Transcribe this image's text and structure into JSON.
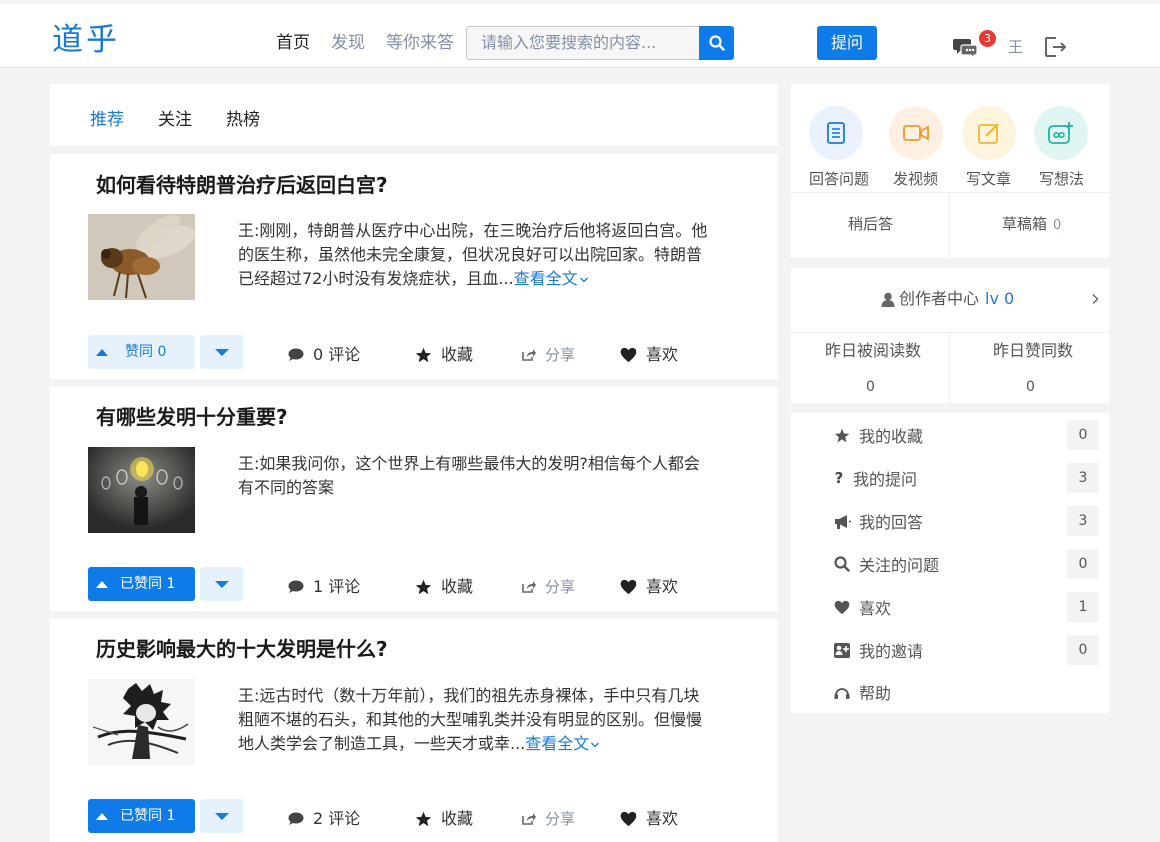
{
  "header": {
    "logo": "道乎",
    "nav": [
      {
        "label": "首页",
        "active": true
      },
      {
        "label": "发现",
        "active": false
      },
      {
        "label": "等你来答",
        "active": false
      }
    ],
    "search_placeholder": "请输入您要搜索的内容...",
    "ask_label": "提问",
    "message_badge": "3",
    "user_name": "王"
  },
  "tabs": [
    {
      "label": "推荐",
      "active": true
    },
    {
      "label": "关注",
      "active": false
    },
    {
      "label": "热榜",
      "active": false
    }
  ],
  "feed": [
    {
      "title": "如何看待特朗普治疗后返回白宫?",
      "excerpt": "王:刚刚，特朗普从医疗中心出院，在三晚治疗后他将返回白宫。他的医生称，虽然他未完全康复，但状况良好可以出院回家。特朗普已经超过72小时没有发烧症状，且血...",
      "read_more": "查看全文",
      "vote_label": "赞同 0",
      "voted": false,
      "comments": "0 评论",
      "collect": "收藏",
      "share": "分享",
      "like": "喜欢"
    },
    {
      "title": "有哪些发明十分重要?",
      "excerpt": "王:如果我问你，这个世界上有哪些最伟大的发明?相信每个人都会有不同的答案",
      "read_more": "",
      "vote_label": "已赞同 1",
      "voted": true,
      "comments": "1 评论",
      "collect": "收藏",
      "share": "分享",
      "like": "喜欢"
    },
    {
      "title": "历史影响最大的十大发明是什么?",
      "excerpt": "王:远古时代（数十万年前），我们的祖先赤身裸体，手中只有几块粗陋不堪的石头，和其他的大型哺乳类并没有明显的区别。但慢慢地人类学会了制造工具，一些天才或幸...",
      "read_more": "查看全文",
      "vote_label": "已赞同 1",
      "voted": true,
      "comments": "2 评论",
      "collect": "收藏",
      "share": "分享",
      "like": "喜欢"
    }
  ],
  "sidebar": {
    "quick_actions": [
      {
        "label": "回答问题",
        "icon": "document-icon",
        "color": "#1a7ad6",
        "bg": "#e8f1fc"
      },
      {
        "label": "发视频",
        "icon": "video-icon",
        "color": "#f0982a",
        "bg": "#fdf0e2"
      },
      {
        "label": "写文章",
        "icon": "edit-icon",
        "color": "#f2b72e",
        "bg": "#fdf4de"
      },
      {
        "label": "写想法",
        "icon": "idea-icon",
        "color": "#1fb3a6",
        "bg": "#e1f5f3"
      }
    ],
    "later_answer": "稍后答",
    "drafts_label": "草稿箱",
    "drafts_count": "0",
    "creator_label": "创作者中心",
    "creator_level": "lv 0",
    "stats": [
      {
        "label": "昨日被阅读数",
        "value": "0"
      },
      {
        "label": "昨日赞同数",
        "value": "0"
      }
    ],
    "menu": [
      {
        "label": "我的收藏",
        "icon": "star-icon",
        "count": "0"
      },
      {
        "label": "我的提问",
        "icon": "question-icon",
        "count": "3"
      },
      {
        "label": "我的回答",
        "icon": "megaphone-icon",
        "count": "3"
      },
      {
        "label": "关注的问题",
        "icon": "search-icon",
        "count": "0"
      },
      {
        "label": "喜欢",
        "icon": "heart-icon",
        "count": "1"
      },
      {
        "label": "我的邀请",
        "icon": "invite-icon",
        "count": "0"
      },
      {
        "label": "帮助",
        "icon": "help-icon",
        "count": ""
      }
    ]
  }
}
